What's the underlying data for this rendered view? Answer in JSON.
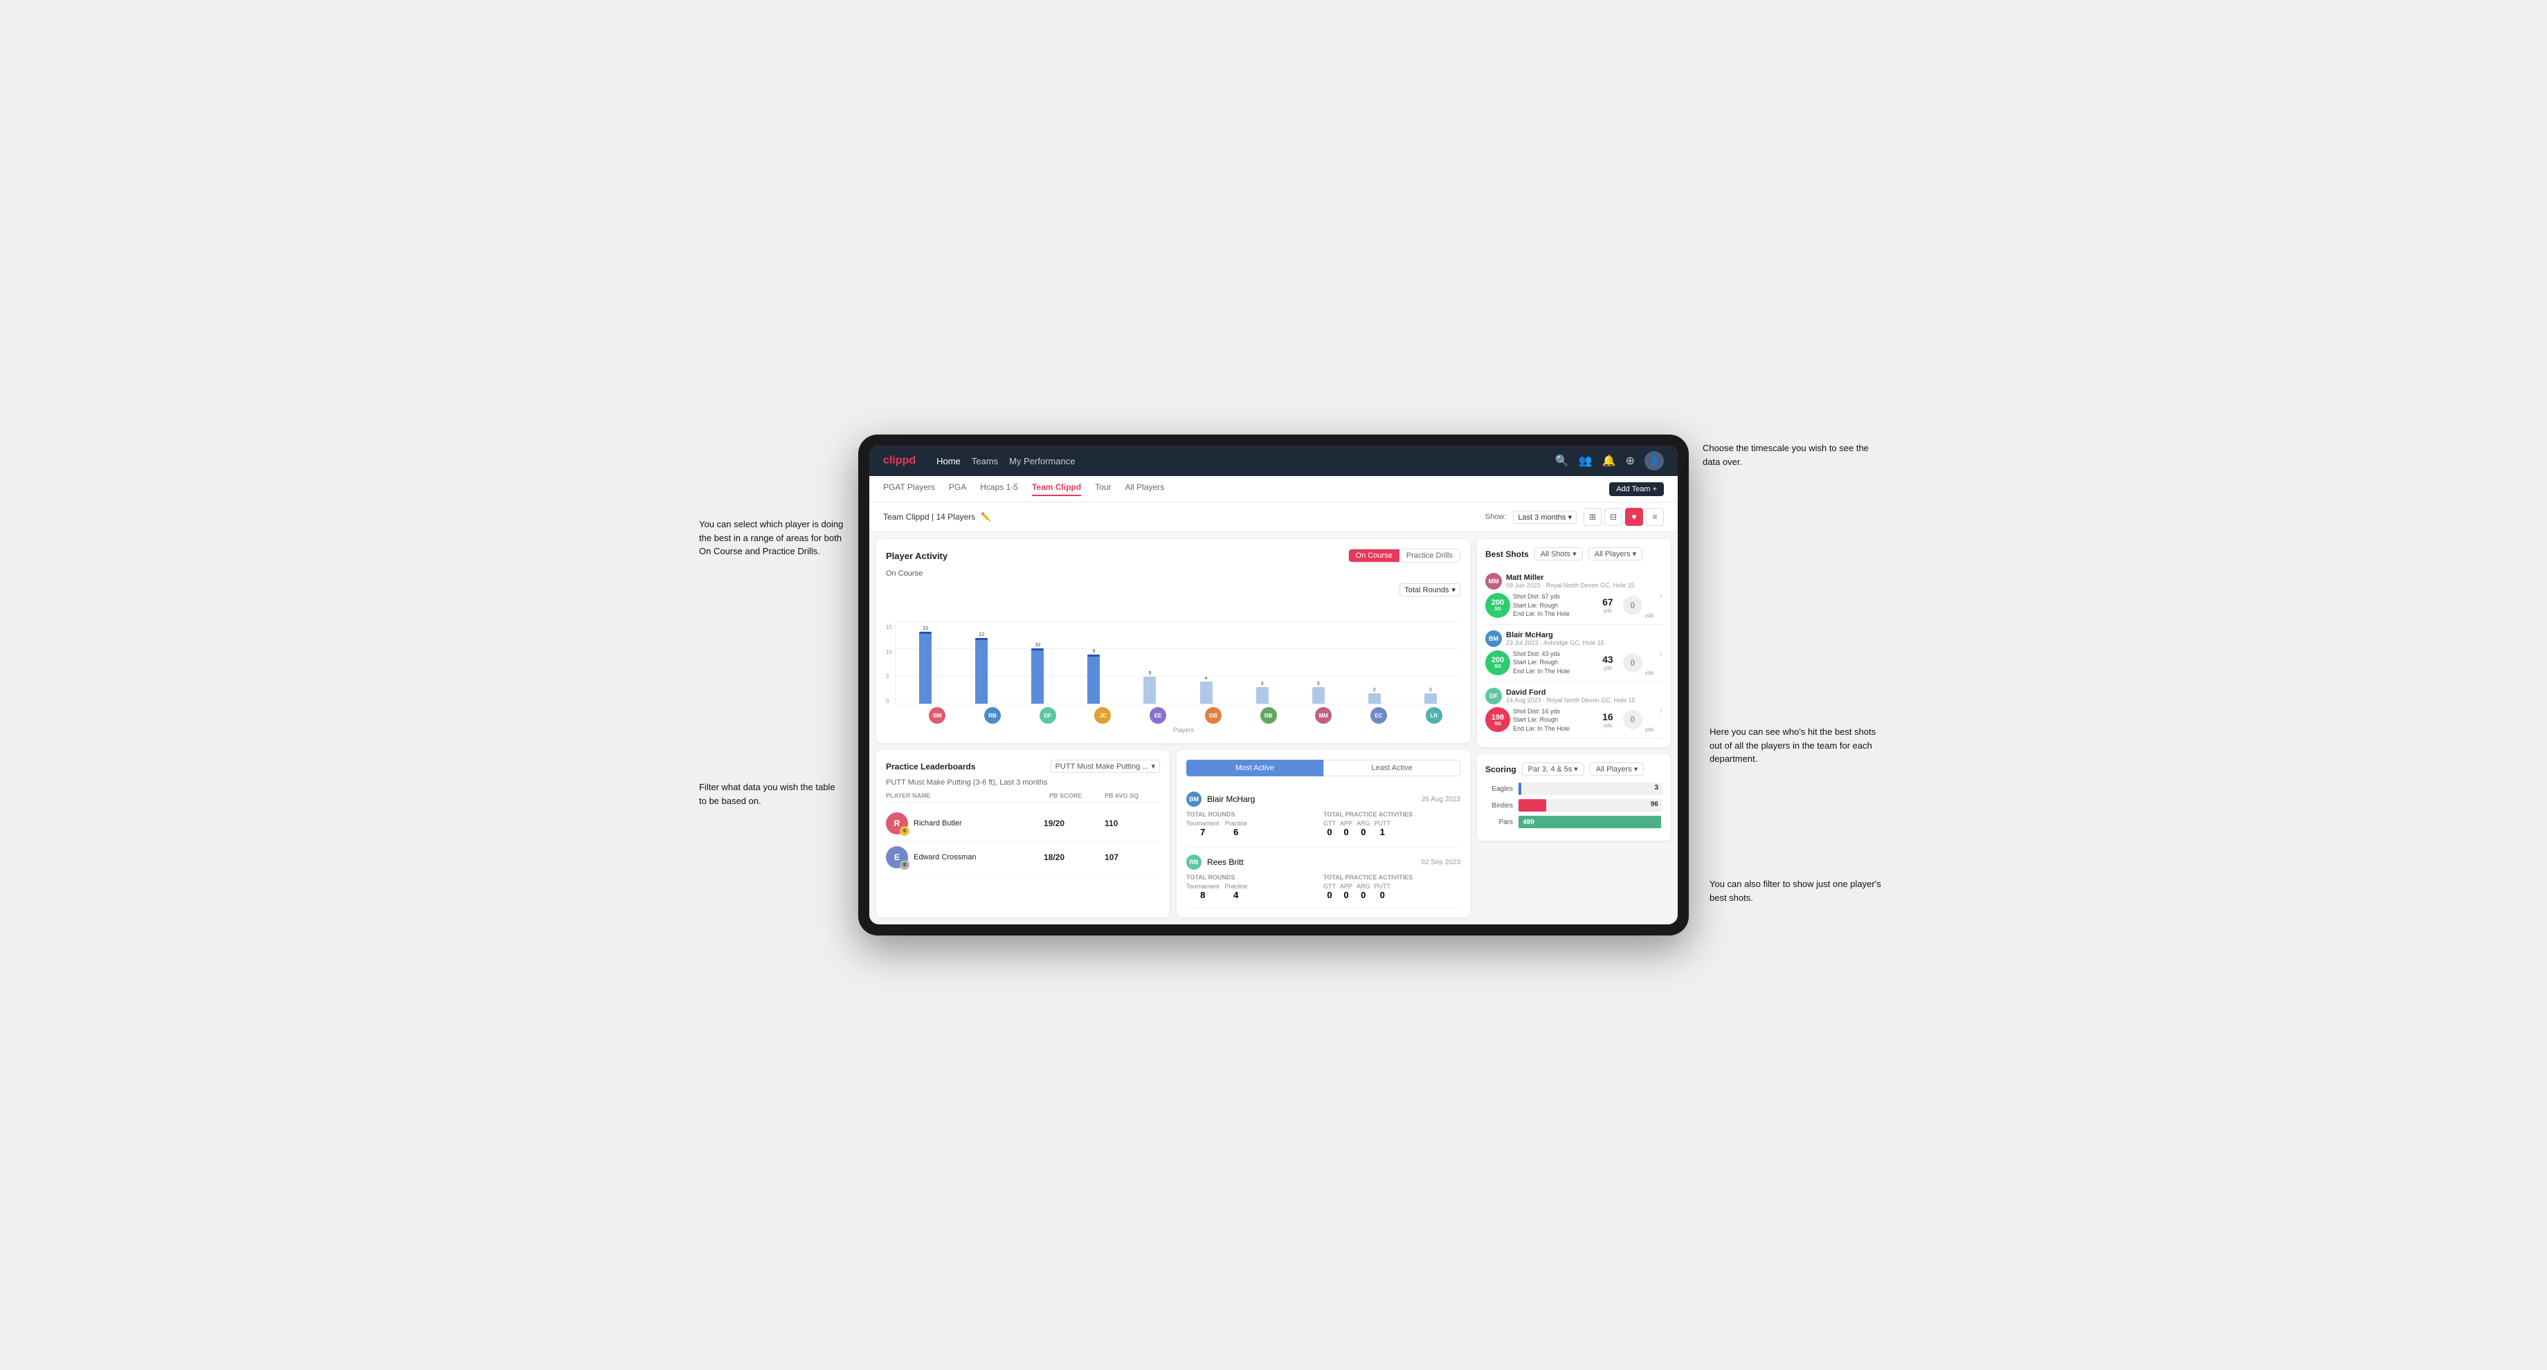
{
  "annotations": {
    "top_right": "Choose the timescale you\nwish to see the data over.",
    "top_left": "You can select which player is\ndoing the best in a range of\nareas for both On Course and\nPractice Drills.",
    "mid_left": "Filter what data you wish the\ntable to be based on.",
    "bottom_right1": "Here you can see who's hit\nthe best shots out of all the\nplayers in the team for\neach department.",
    "bottom_right2": "You can also filter to show\njust one player's best shots."
  },
  "nav": {
    "logo": "clippd",
    "links": [
      "Home",
      "Teams",
      "My Performance"
    ],
    "icons": [
      "🔍",
      "👥",
      "🔔",
      "⊕",
      "👤"
    ]
  },
  "tabs": {
    "items": [
      "PGAT Players",
      "PGA",
      "Hcaps 1-5",
      "Team Clippd",
      "Tour",
      "All Players"
    ],
    "active": "Team Clippd",
    "add_team": "Add Team +"
  },
  "subheader": {
    "title": "Team Clippd | 14 Players",
    "show_label": "Show:",
    "timescale": "Last 3 months",
    "view_icons": [
      "⊞",
      "⊟",
      "♥",
      "≡"
    ]
  },
  "player_activity": {
    "title": "Player Activity",
    "toggle": [
      "On Course",
      "Practice Drills"
    ],
    "active_toggle": "On Course",
    "section_label": "On Course",
    "chart_dropdown": "Total Rounds",
    "y_labels": [
      "15",
      "10",
      "5",
      "0"
    ],
    "x_label": "Players",
    "bars": [
      {
        "name": "B. McHarg",
        "value": 13,
        "color": "#5b8cdc",
        "height_pct": 87
      },
      {
        "name": "R. Britt",
        "value": 12,
        "color": "#5b8cdc",
        "height_pct": 80
      },
      {
        "name": "D. Ford",
        "value": 10,
        "color": "#5b8cdc",
        "height_pct": 67
      },
      {
        "name": "J. Coles",
        "value": 9,
        "color": "#5b8cdc",
        "height_pct": 60
      },
      {
        "name": "E. Ebert",
        "value": 5,
        "color": "#b0c8e8",
        "height_pct": 33
      },
      {
        "name": "O. Billingham",
        "value": 4,
        "color": "#b0c8e8",
        "height_pct": 27
      },
      {
        "name": "R. Butler",
        "value": 3,
        "color": "#b0c8e8",
        "height_pct": 20
      },
      {
        "name": "M. Miller",
        "value": 3,
        "color": "#b0c8e8",
        "height_pct": 20
      },
      {
        "name": "E. Crossman",
        "value": 2,
        "color": "#b0c8e8",
        "height_pct": 13
      },
      {
        "name": "L. Robertson",
        "value": 2,
        "color": "#b0c8e8",
        "height_pct": 13
      }
    ],
    "avatar_colors": [
      "#e05a70",
      "#4a8cc8",
      "#5bc8a0",
      "#e0a030",
      "#8a70cc",
      "#e08040",
      "#60a860",
      "#c06080",
      "#7088c8",
      "#50b0b0"
    ]
  },
  "practice_leaderboards": {
    "title": "Practice Leaderboards",
    "filter": "PUTT Must Make Putting ...",
    "subtitle": "PUTT Must Make Putting (3-6 ft), Last 3 months",
    "columns": [
      "Player Name",
      "PB Score",
      "PB Avg SQ"
    ],
    "rows": [
      {
        "name": "Richard Butler",
        "pb_score": "19/20",
        "pb_avg": "110",
        "rank": 1,
        "color": "#e05a70"
      },
      {
        "name": "Edward Crossman",
        "pb_score": "18/20",
        "pb_avg": "107",
        "rank": 2,
        "color": "#7088c8"
      }
    ]
  },
  "most_active": {
    "toggle": [
      "Most Active",
      "Least Active"
    ],
    "active": "Most Active",
    "players": [
      {
        "name": "Blair McHarg",
        "date": "26 Aug 2023",
        "total_rounds_label": "Total Rounds",
        "tournament": 7,
        "practice": 6,
        "total_practice_label": "Total Practice Activities",
        "gtt": 0,
        "app": 0,
        "arg": 0,
        "putt": 1,
        "color": "#4a8cc8"
      },
      {
        "name": "Rees Britt",
        "date": "02 Sep 2023",
        "total_rounds_label": "Total Rounds",
        "tournament": 8,
        "practice": 4,
        "total_practice_label": "Total Practice Activities",
        "gtt": 0,
        "app": 0,
        "arg": 0,
        "putt": 0,
        "color": "#5bc8a0"
      }
    ]
  },
  "best_shots": {
    "title": "Best Shots",
    "filter1": "All Shots",
    "filter2": "All Players",
    "shots": [
      {
        "player": "Matt Miller",
        "date": "09 Jun 2023 · Royal North Devon GC, Hole 15",
        "sg": "200",
        "sg_label": "SG",
        "info": "Shot Dist: 67 yds\nStart Lie: Rough\nEnd Lie: In The Hole",
        "dist": "67",
        "dist_unit": "yds",
        "zero": "0",
        "zero_unit": "yds",
        "color": "#2ecc71"
      },
      {
        "player": "Blair McHarg",
        "date": "23 Jul 2023 · Ashridge GC, Hole 15",
        "sg": "200",
        "sg_label": "SG",
        "info": "Shot Dist: 43 yds\nStart Lie: Rough\nEnd Lie: In The Hole",
        "dist": "43",
        "dist_unit": "yds",
        "zero": "0",
        "zero_unit": "yds",
        "color": "#2ecc71"
      },
      {
        "player": "David Ford",
        "date": "24 Aug 2023 · Royal North Devon GC, Hole 15",
        "sg": "198",
        "sg_label": "SG",
        "info": "Shot Dist: 16 yds\nStart Lie: Rough\nEnd Lie: In The Hole",
        "dist": "16",
        "dist_unit": "yds",
        "zero": "0",
        "zero_unit": "yds",
        "color": "#e8385a"
      }
    ]
  },
  "scoring": {
    "title": "Scoring",
    "filter1": "Par 3, 4 & 5s",
    "filter2": "All Players",
    "rows": [
      {
        "label": "Eagles",
        "value": 3,
        "bar_pct": 2,
        "color": "#3a7bd5"
      },
      {
        "label": "Birdies",
        "value": 96,
        "bar_pct": 19,
        "color": "#e8385a"
      },
      {
        "label": "Pars",
        "value": 499,
        "bar_pct": 99,
        "color": "#4caf88"
      }
    ]
  }
}
